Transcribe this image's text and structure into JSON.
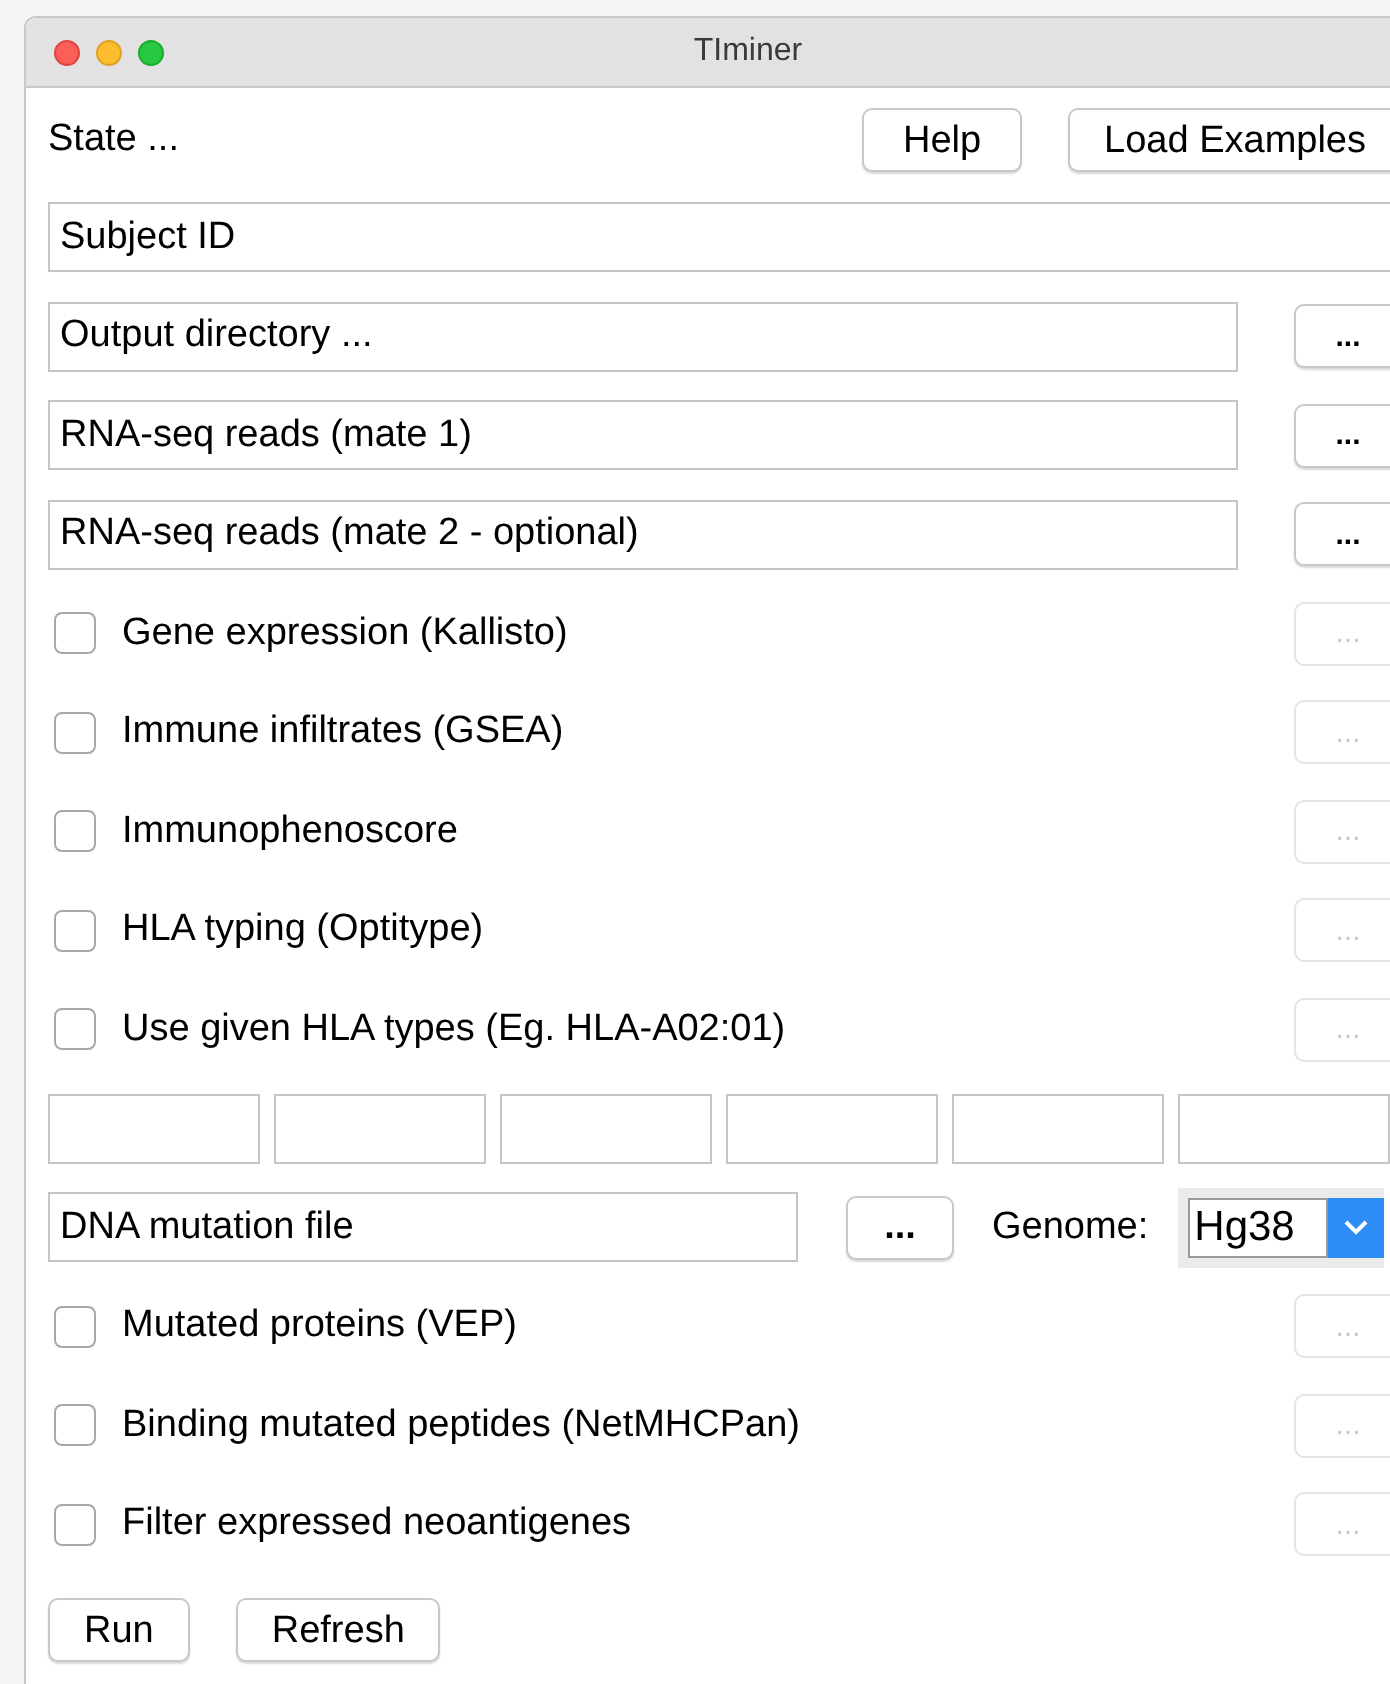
{
  "window": {
    "title": "TIminer"
  },
  "state_label": "State ...",
  "header_buttons": [
    "Help",
    "Load Examples"
  ],
  "rows": [
    {
      "kind": "field",
      "value": "Subject ID"
    },
    {
      "kind": "file",
      "value": "Output directory ...",
      "button": "..."
    },
    {
      "kind": "file",
      "value": "RNA-seq reads (mate 1)",
      "button": "..."
    },
    {
      "kind": "file",
      "value": "RNA-seq reads (mate 2 - optional)",
      "button": "..."
    },
    {
      "kind": "check",
      "label": "Gene expression (Kallisto)",
      "checked": false,
      "button": "...",
      "button_disabled": true
    },
    {
      "kind": "check",
      "label": "Immune infiltrates (GSEA)",
      "checked": false,
      "button": "...",
      "button_disabled": true
    },
    {
      "kind": "check",
      "label": "Immunophenoscore",
      "checked": false,
      "button": "...",
      "button_disabled": true
    },
    {
      "kind": "check",
      "label": "HLA typing (Optitype)",
      "checked": false,
      "button": "...",
      "button_disabled": true
    },
    {
      "kind": "check",
      "label": "Use given HLA types (Eg. HLA-A02:01)",
      "checked": false,
      "button": "...",
      "button_disabled": true
    },
    {
      "kind": "inputs",
      "fields": [
        {
          "kind": "text"
        },
        {
          "kind": "text"
        },
        {
          "kind": "text"
        },
        {
          "kind": "text"
        },
        {
          "kind": "text"
        },
        {
          "kind": "text"
        }
      ]
    },
    {
      "kind": "mutation",
      "value": "DNA mutation file",
      "button": "...",
      "genome_label": "Genome:",
      "genome": "Hg38"
    },
    {
      "kind": "check",
      "label": "Mutated proteins (VEP)",
      "checked": false,
      "button": "...",
      "button_disabled": true
    },
    {
      "kind": "check",
      "label": "Binding mutated peptides (NetMHCPan)",
      "checked": false,
      "button": "...",
      "button_disabled": true
    },
    {
      "kind": "check",
      "label": "Filter expressed neoantigenes",
      "checked": false,
      "button": "...",
      "button_disabled": true
    }
  ],
  "footer_buttons": [
    "Run",
    "Refresh"
  ]
}
